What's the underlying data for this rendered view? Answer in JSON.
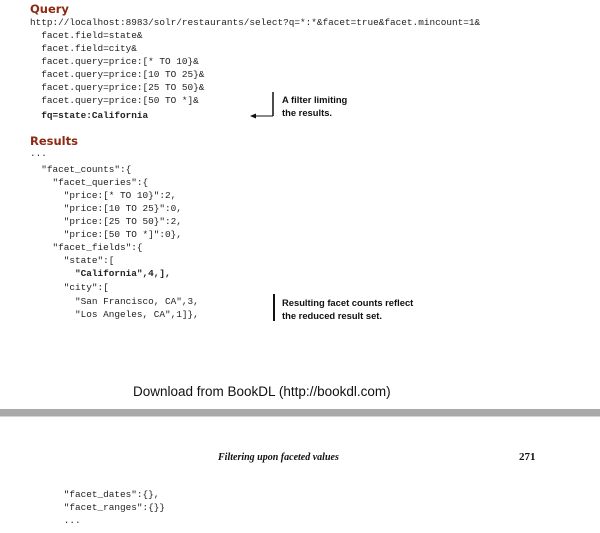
{
  "query": {
    "heading": "Query",
    "lines": [
      "http://localhost:8983/solr/restaurants/select?q=*:*&facet=true&facet.mincount=1&",
      "  facet.field=state&",
      "  facet.field=city&",
      "  facet.query=price:[* TO 10}&",
      "  facet.query=price:[10 TO 25}&",
      "  facet.query=price:[25 TO 50}&",
      "  facet.query=price:[50 TO *]&",
      "  fq=state:California"
    ],
    "annotation": [
      "A filter limiting",
      "the results."
    ]
  },
  "results": {
    "heading": "Results",
    "lines": [
      "...",
      "  \"facet_counts\":{",
      "    \"facet_queries\":{",
      "      \"price:[* TO 10}\":2,",
      "      \"price:[10 TO 25}\":0,",
      "      \"price:[25 TO 50}\":2,",
      "      \"price:[50 TO *]\":0},",
      "    \"facet_fields\":{",
      "      \"state\":[",
      "        \"California\",4,],",
      "      \"city\":[",
      "        \"San Francisco, CA\",3,",
      "        \"Los Angeles, CA\",1]},"
    ],
    "annotation": [
      "Resulting facet counts reflect",
      "the reduced result set."
    ]
  },
  "credit": "Download from BookDL (http://bookdl.com)",
  "page": {
    "running_head": "Filtering upon faceted values",
    "number": "271"
  },
  "continuation": {
    "lines": [
      "      \"facet_dates\":{},",
      "      \"facet_ranges\":{}}",
      "      ..."
    ]
  }
}
